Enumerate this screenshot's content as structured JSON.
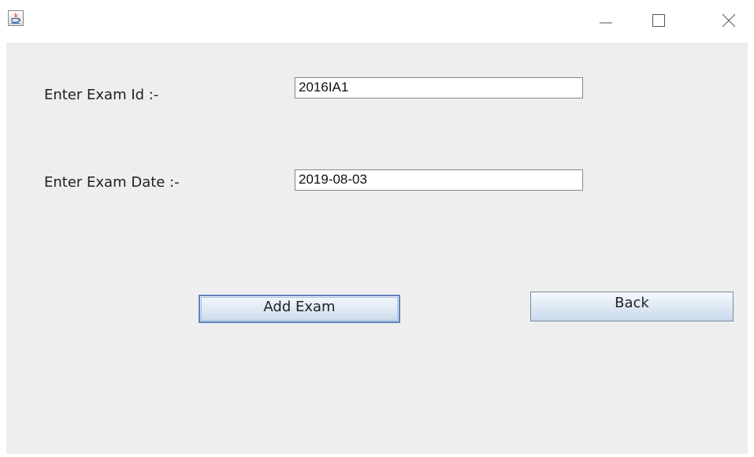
{
  "window": {
    "title": "",
    "controls": {
      "minimize": "minimize-icon",
      "maximize": "maximize-icon",
      "close": "close-icon"
    },
    "app_icon": "java-icon"
  },
  "form": {
    "exam_id_label": "Enter Exam Id :-",
    "exam_id_value": "2016IA1",
    "exam_date_label": "Enter Exam Date :-",
    "exam_date_value": "2019-08-03"
  },
  "buttons": {
    "add_exam_label": "Add Exam",
    "back_label": "Back"
  },
  "colors": {
    "panel_background": "#eeeeee",
    "focus_border": "#6382be"
  }
}
